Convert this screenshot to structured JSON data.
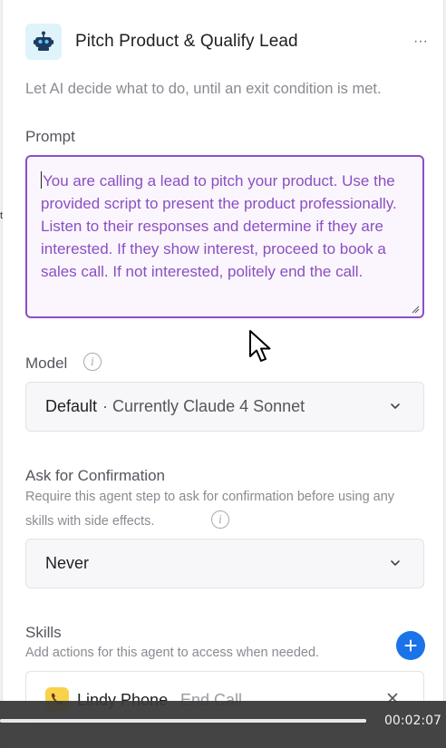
{
  "header": {
    "title": "Pitch Product & Qualify Lead",
    "menu_glyph": "···"
  },
  "description": "Let AI decide what to do, until an exit condition is met.",
  "stray_text": "t",
  "prompt": {
    "label": "Prompt",
    "value": "You are calling a lead to pitch your product. Use the provided script to present the product professionally. Listen to their responses and determine if they are interested. If they show interest, proceed to book a sales call. If not interested, politely end the call."
  },
  "model": {
    "label": "Model",
    "selected": "Default",
    "detail": "· Currently Claude 4 Sonnet"
  },
  "confirmation": {
    "label": "Ask for Confirmation",
    "hint": "Require this agent step to ask for confirmation before using any skills with side effects.",
    "selected": "Never"
  },
  "skills": {
    "label": "Skills",
    "hint": "Add actions for this agent to access when needed.",
    "items": [
      {
        "name": "Lindy Phone",
        "action": "End Call"
      }
    ]
  },
  "video": {
    "time": "00:02:07",
    "progress": 1.0
  },
  "colors": {
    "accent_purple": "#8d4fc8",
    "prompt_text": "#8a4fc2",
    "add_button": "#1a73e8",
    "bot_icon_bg": "#dff3fb",
    "phone_icon_bg": "#f7d24a"
  },
  "icons": {
    "header": "robot-icon",
    "menu": "more-horizontal-icon",
    "info": "info-icon",
    "select": "chevron-down-icon",
    "add": "plus-icon",
    "skill": "phone-icon",
    "remove": "close-icon"
  }
}
